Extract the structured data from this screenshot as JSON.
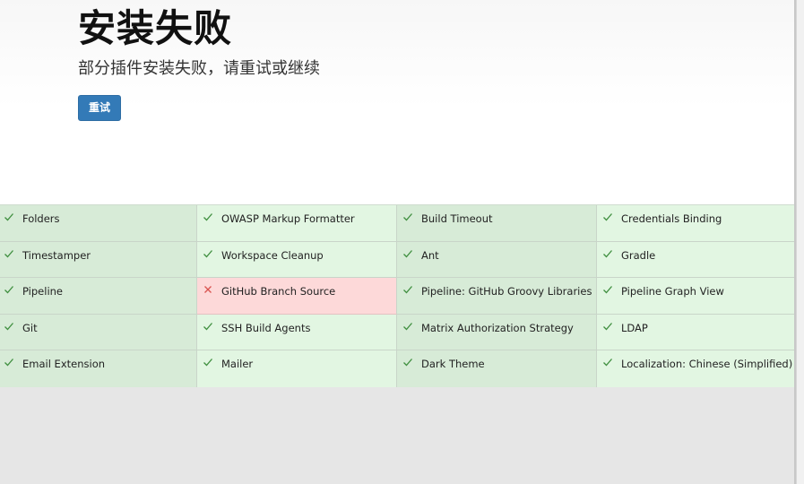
{
  "header": {
    "title": "安装失败",
    "subtitle": "部分插件安装失败，请重试或继续",
    "retry_label": "重试"
  },
  "colors": {
    "success_bg": "#e2f6e2",
    "success_bg_alt": "#d7ebd7",
    "failed_bg": "#fdd9d9",
    "check_color": "#3f8f3f",
    "cross_color": "#d9534f",
    "button_bg": "#337ab7"
  },
  "plugins": [
    [
      {
        "name": "Folders",
        "status": "success"
      },
      {
        "name": "OWASP Markup Formatter",
        "status": "success"
      },
      {
        "name": "Build Timeout",
        "status": "success"
      },
      {
        "name": "Credentials Binding",
        "status": "success"
      }
    ],
    [
      {
        "name": "Timestamper",
        "status": "success"
      },
      {
        "name": "Workspace Cleanup",
        "status": "success"
      },
      {
        "name": "Ant",
        "status": "success"
      },
      {
        "name": "Gradle",
        "status": "success"
      }
    ],
    [
      {
        "name": "Pipeline",
        "status": "success"
      },
      {
        "name": "GitHub Branch Source",
        "status": "failed"
      },
      {
        "name": "Pipeline: GitHub Groovy Libraries",
        "status": "success"
      },
      {
        "name": "Pipeline Graph View",
        "status": "success"
      }
    ],
    [
      {
        "name": "Git",
        "status": "success"
      },
      {
        "name": "SSH Build Agents",
        "status": "success"
      },
      {
        "name": "Matrix Authorization Strategy",
        "status": "success"
      },
      {
        "name": "LDAP",
        "status": "success"
      }
    ],
    [
      {
        "name": "Email Extension",
        "status": "success"
      },
      {
        "name": "Mailer",
        "status": "success"
      },
      {
        "name": "Dark Theme",
        "status": "success"
      },
      {
        "name": "Localization: Chinese (Simplified)",
        "status": "success"
      }
    ]
  ]
}
